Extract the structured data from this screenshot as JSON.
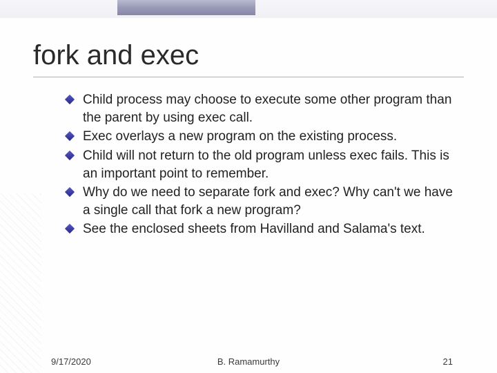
{
  "title": "fork and exec",
  "bullets": [
    "Child process may choose to execute some other program than the parent by using exec call.",
    "Exec overlays a new program on the existing process.",
    "Child will not return to the old program unless exec fails. This is an important point to remember.",
    "Why do we need to separate fork and exec? Why can't we have a single call that fork a new program?",
    "See the enclosed sheets from Havilland and Salama's text."
  ],
  "footer": {
    "date": "9/17/2020",
    "author": "B. Ramamurthy",
    "page": "21"
  }
}
